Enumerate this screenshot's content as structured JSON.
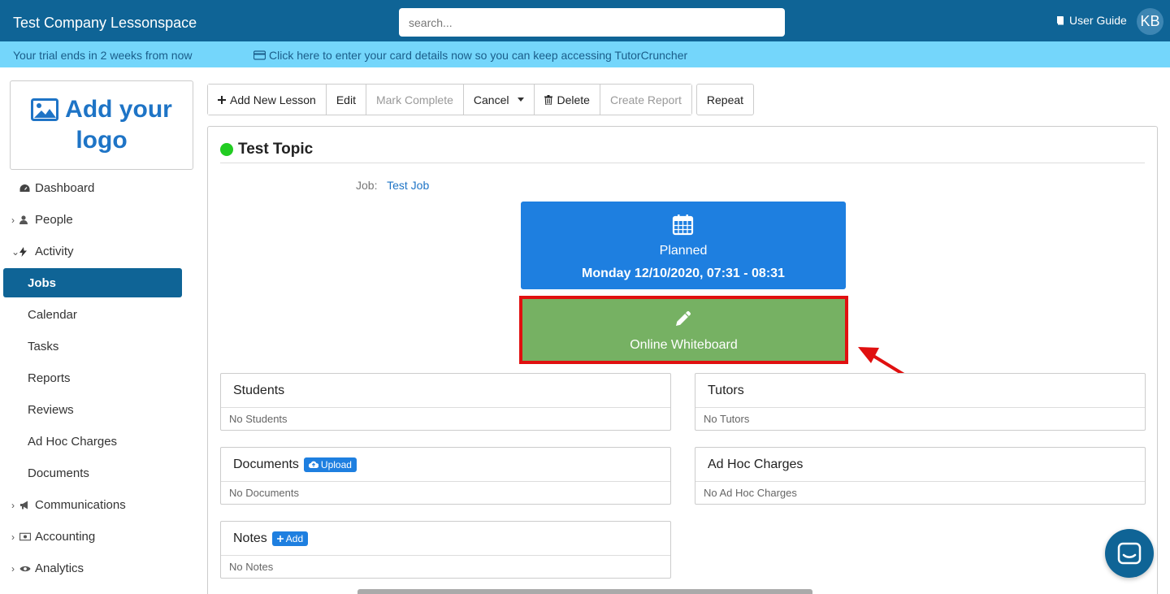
{
  "header": {
    "brand": "Test Company Lessonspace",
    "search_placeholder": "search...",
    "user_guide": "User Guide",
    "avatar_initials": "KB"
  },
  "banner": {
    "trial_text": "Your trial ends in 2 weeks from now",
    "card_link": "Click here to enter your card details now so you can keep accessing TutorCruncher"
  },
  "logo": {
    "line1": "Add your",
    "line2": "logo"
  },
  "sidebar": {
    "items": [
      {
        "label": "Dashboard",
        "icon": "dashboard-icon"
      },
      {
        "label": "People",
        "icon": "user-icon"
      },
      {
        "label": "Activity",
        "icon": "bolt-icon"
      },
      {
        "label": "Jobs"
      },
      {
        "label": "Calendar"
      },
      {
        "label": "Tasks"
      },
      {
        "label": "Reports"
      },
      {
        "label": "Reviews"
      },
      {
        "label": "Ad Hoc Charges"
      },
      {
        "label": "Documents"
      },
      {
        "label": "Communications",
        "icon": "megaphone-icon"
      },
      {
        "label": "Accounting",
        "icon": "money-icon"
      },
      {
        "label": "Analytics",
        "icon": "eye-icon"
      }
    ]
  },
  "toolbar": {
    "add_new_lesson": "Add New Lesson",
    "edit": "Edit",
    "mark_complete": "Mark Complete",
    "cancel": "Cancel",
    "delete": "Delete",
    "create_report": "Create Report",
    "repeat": "Repeat"
  },
  "lesson": {
    "topic": "Test Topic",
    "job_label": "Job:",
    "job_name": "Test Job",
    "status": "Planned",
    "datetime": "Monday 12/10/2020, 07:31 - 08:31",
    "whiteboard_label": "Online Whiteboard"
  },
  "panels": {
    "students": {
      "title": "Students",
      "empty": "No Students"
    },
    "tutors": {
      "title": "Tutors",
      "empty": "No Tutors"
    },
    "documents": {
      "title": "Documents",
      "action": "Upload",
      "empty": "No Documents"
    },
    "adhoc": {
      "title": "Ad Hoc Charges",
      "empty": "No Ad Hoc Charges"
    },
    "notes": {
      "title": "Notes",
      "action": "Add",
      "empty": "No Notes"
    }
  },
  "colors": {
    "nav_blue": "#0f6496",
    "banner_cyan": "#74d6fb",
    "planned_blue": "#1e7fe0",
    "whiteboard_green": "#76b163",
    "highlight_red": "#e01010",
    "status_green": "#22cc22"
  }
}
